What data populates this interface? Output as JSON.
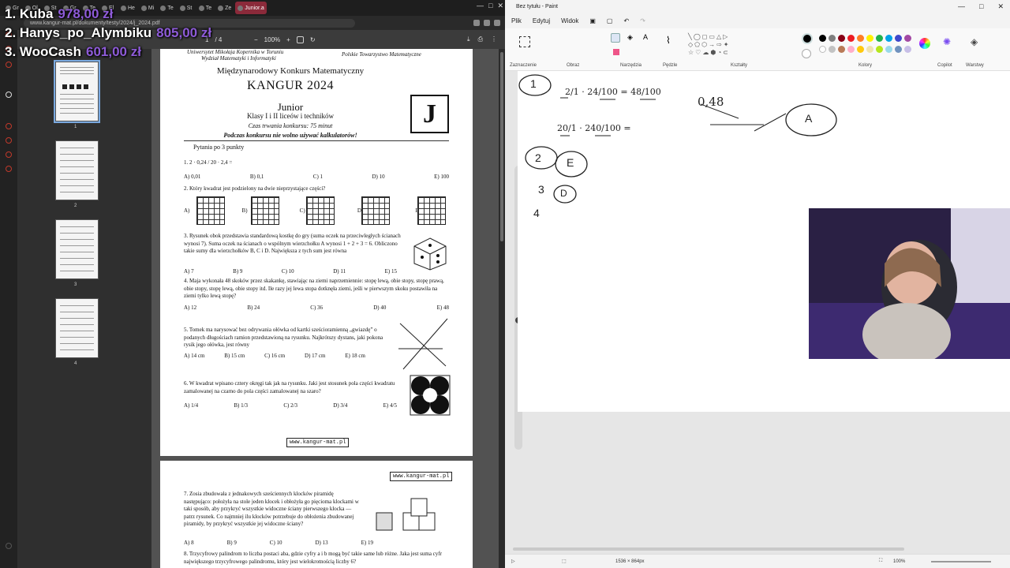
{
  "overlay": {
    "rows": [
      {
        "rank_name": "1. Kuba",
        "amount": "978,00 zł"
      },
      {
        "rank_name": "2. Hanys_po_Alymbiku",
        "amount": "805,00 zł"
      },
      {
        "rank_name": "3. WooCash",
        "amount": "601,00 zł"
      }
    ]
  },
  "browser": {
    "tabs": [
      "Gr",
      "Ol",
      "St",
      "Gr",
      "Te",
      "El",
      "He",
      "Mi",
      "Te",
      "St",
      "Te",
      "Ze",
      "Junior.a"
    ],
    "url": "www.kangur-mat.pl/dokumenty/testy/2024/j_2024.pdf",
    "window_controls": [
      "—",
      "□",
      "✕"
    ]
  },
  "pdf_toolbar": {
    "page": "1",
    "page_total": "/ 4",
    "zoom": "100%"
  },
  "thumbnails": [
    "1",
    "2",
    "3",
    "4"
  ],
  "pdf_page1": {
    "header_left": "Uniwersytet Mikołaja Kopernika w Toruniu",
    "header_left2": "Wydział Matematyki i Informatyki",
    "header_right": "Polskie Towarzystwo Matematyczne",
    "title": "Międzynarodowy Konkurs Matematyczny",
    "kangur": "KANGUR 2024",
    "level": "Junior",
    "classes": "Klasy I i II liceów i techników",
    "duration": "Czas trwania konkursu: 75 minut",
    "calculators": "Podczas konkursu nie wolno używać kalkulatorów!",
    "badge": "J",
    "section": "Pytania po 3 punkty",
    "q1": "1. 2 · 0,24 / 20 · 2,4 =",
    "q1_answers": [
      "A) 0,01",
      "B) 0,1",
      "C) 1",
      "D) 10",
      "E) 100"
    ],
    "q2": "2. Który kwadrat jest podzielony na dwie nieprzystające części?",
    "q2_answers": [
      "A)",
      "B)",
      "C)",
      "D)",
      "E)"
    ],
    "q3": "3. Rysunek obok przedstawia standardową kostkę do gry (suma oczek na przeciwległych ścianach wynosi 7). Suma oczek na ścianach o wspólnym wierzchołku A wynosi 1 + 2 + 3 = 6. Obliczono takie sumy dla wierzchołków B, C i D. Największa z tych sum jest równa",
    "q3_answers": [
      "A) 7",
      "B) 9",
      "C) 10",
      "D) 11",
      "E) 15"
    ],
    "q4": "4. Maja wykonała 48 skoków przez skakankę, stawiając na ziemi naprzemiennie: stopę lewą, obie stopy, stopę prawą, obie stopy, stopę lewą, obie stopy itd. Ile razy jej lewa stopa dotknęła ziemi, jeśli w pierwszym skoku postawiła na ziemi tylko lewą stopę?",
    "q4_answers": [
      "A) 12",
      "B) 24",
      "C) 36",
      "D) 40",
      "E) 48"
    ],
    "q5": "5. Tomek ma narysować bez odrywania ołówka od kartki sześcioramienną „gwiazdę” o podanych długościach ramion przedstawioną na rysunku. Najkrótszy dystans, jaki pokona rysik jego ołówka, jest równy",
    "q5_answers": [
      "A) 14 cm",
      "B) 15 cm",
      "C) 16 cm",
      "D) 17 cm",
      "E) 18 cm"
    ],
    "q6": "6. W kwadrat wpisano cztery okręgi tak jak na rysunku. Jaki jest stosunek pola części kwadratu zamalowanej na czarno do pola części zamalowanej na szaro?",
    "q6_answers": [
      "A) 1/4",
      "B) 1/3",
      "C) 2/3",
      "D) 3/4",
      "E) 4/5"
    ],
    "footer_url": "www.kangur-mat.pl"
  },
  "pdf_page2": {
    "header_url": "www.kangur-mat.pl",
    "q7": "7. Zosia zbudowała z jednakowych sześciennych klocków piramidę następująco: położyła na stole jeden klocek i obłożyła go pięcioma klockami w taki sposób, aby przykryć wszystkie widoczne ściany pierwszego klocka — patrz rysunek. Co najmniej ilu klocków potrzebuje do obłożenia zbudowanej piramidy, by przykryć wszystkie jej widoczne ściany?",
    "q7_answers": [
      "A) 8",
      "B) 9",
      "C) 10",
      "D) 13",
      "E) 19"
    ],
    "q8": "8. Trzycyfrowy palindrom to liczba postaci aba, gdzie cyfry a i b mogą być takie same lub różne. Jaka jest suma cyfr największego trzycyfrowego palindromu, który jest wielokrotnością liczby 6?"
  },
  "paint": {
    "title": "Bez tytułu - Paint",
    "menu": [
      "Plik",
      "Edytuj",
      "Widok"
    ],
    "groups": [
      "Zaznaczenie",
      "Obraz",
      "Narzędzia",
      "Pędzle",
      "Kształty",
      "Kolory",
      "Copilot",
      "Warstwy"
    ],
    "status_size": "1536 × 864px",
    "zoom": "100%",
    "palette": [
      "#000000",
      "#7f7f7f",
      "#880015",
      "#ed1c24",
      "#ff7f27",
      "#fff200",
      "#22b14c",
      "#00a2e8",
      "#3f48cc",
      "#a349a4",
      "#ffffff",
      "#c3c3c3",
      "#b97a57",
      "#ffaec9",
      "#ffc90e",
      "#efe4b0",
      "#b5e61d",
      "#99d9ea",
      "#7092be",
      "#c8bfe7"
    ],
    "handwriting": {
      "r1": "2/1 · 24/100 = 48/100",
      "r2": "20/1 · 240/100 =",
      "note": "0,48",
      "ans1": "A",
      "ans2": "E",
      "ans3": "D",
      "n4": "4",
      "n1": "1",
      "n2": "2",
      "n3": "3"
    }
  }
}
